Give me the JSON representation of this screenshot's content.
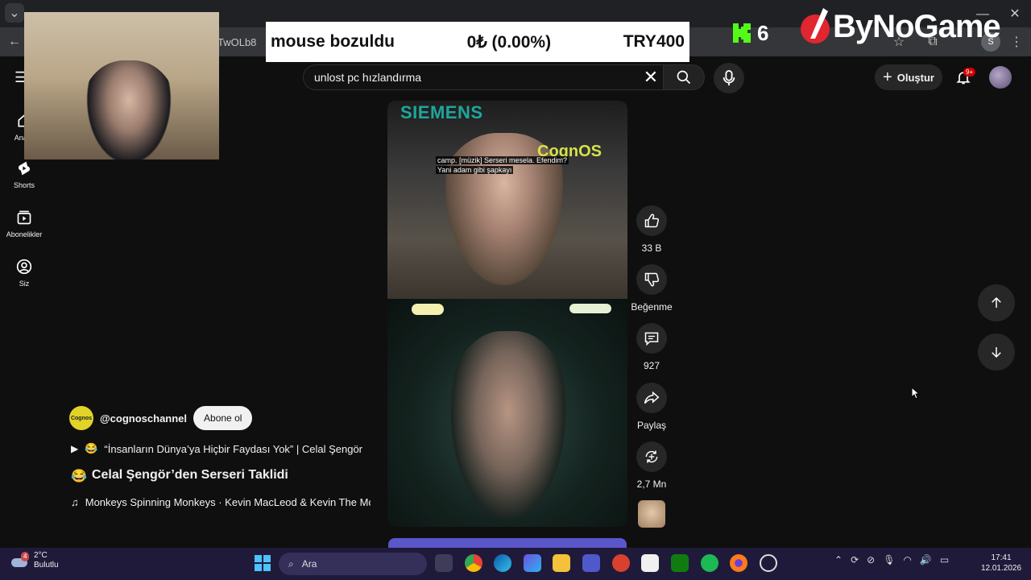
{
  "browser": {
    "url_fragment": "TwOLb8"
  },
  "overlay": {
    "price_banner": {
      "title": "mouse bozuldu",
      "amount": "0₺ (0.00%)",
      "target": "TRY400"
    },
    "kick_count": "6",
    "brand_name": "ByNoGame"
  },
  "youtube": {
    "search": {
      "query": "unlost pc hızlandırma"
    },
    "create_label": "Oluştur",
    "notif_count": "9+",
    "sidebar": [
      {
        "label": "Ana S",
        "icon": "home-icon"
      },
      {
        "label": "Shorts",
        "icon": "shorts-icon"
      },
      {
        "label": "Abonelikler",
        "icon": "subscriptions-icon"
      },
      {
        "label": "Siz",
        "icon": "you-icon"
      }
    ],
    "video": {
      "sponsor_text": "SIEMENS",
      "watermark": "CognOS",
      "subtitle_line1": "camp. [müzik] Serseri mesela. Efendim?",
      "subtitle_line2": "Yani adam gibi şapkayı"
    },
    "actions": {
      "likes": "33 B",
      "dislike_label": "Beğenme",
      "comments": "927",
      "share_label": "Paylaş",
      "remix_count": "2,7 Mn"
    },
    "channel": {
      "handle": "@cognoschannel",
      "avatar_text": "Cognos",
      "subscribe_label": "Abone ol"
    },
    "related_video": "“İnsanların Dünya’ya Hiçbir Faydası Yok” | Celal Şengör",
    "title": "Celal Şengör’den Serseri Taklidi",
    "music": "Monkeys Spinning Monkeys · Kevin MacLeod & Kevin The Monkey"
  },
  "taskbar": {
    "weather_temp": "2°C",
    "weather_desc": "Bulutlu",
    "weather_badge": "4",
    "search_placeholder": "Ara",
    "time": "17:41",
    "date": "12.01.2026"
  },
  "colors": {
    "accent_red": "#cc0000",
    "siemens_teal": "#1fa69b",
    "kick_green": "#53fc18"
  }
}
